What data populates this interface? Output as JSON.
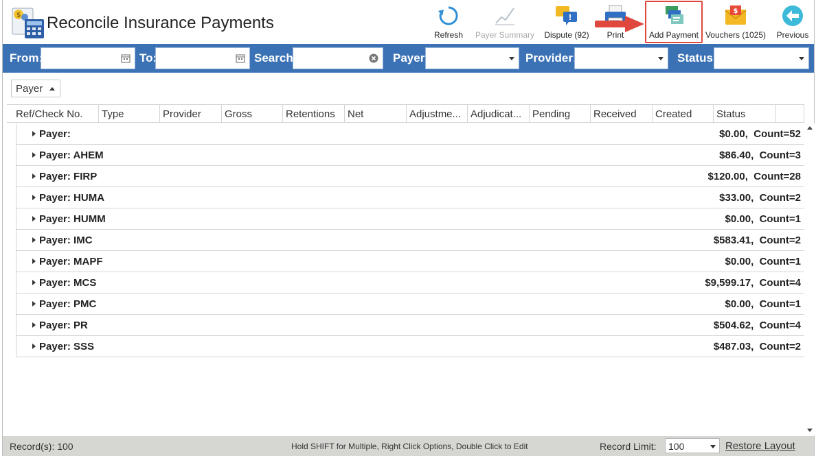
{
  "header": {
    "title": "Reconcile Insurance Payments",
    "app_icon": "calculator-dollar-icon"
  },
  "toolbar": {
    "refresh": {
      "label": "Refresh",
      "icon": "refresh-icon"
    },
    "payer_summary": {
      "label": "Payer Summary",
      "icon": "line-chart-icon",
      "disabled": true
    },
    "dispute": {
      "label": "Dispute (92)",
      "icon": "chat-bubbles-icon"
    },
    "print": {
      "label": "Print",
      "icon": "printer-icon"
    },
    "add_payment": {
      "label": "Add Payment",
      "icon": "add-payment-icon",
      "highlighted": true
    },
    "vouchers": {
      "label": "Vouchers (1025)",
      "icon": "envelope-dollar-icon"
    },
    "previous": {
      "label": "Previous",
      "icon": "back-arrow-icon"
    }
  },
  "filters": {
    "from_label": "From:",
    "from_value": "",
    "to_label": "To:",
    "to_value": "",
    "search_label": "Search:",
    "search_value": "",
    "payer_label": "Payer:",
    "payer_value": "",
    "provider_label": "Provider:",
    "provider_value": "",
    "status_label": "Status:",
    "status_value": ""
  },
  "group_by": {
    "label": "Payer"
  },
  "grid": {
    "columns": [
      "Ref/Check No.",
      "Type",
      "Provider",
      "Gross",
      "Retentions",
      "Net",
      "Adjustme...",
      "Adjudicat...",
      "Pending",
      "Received",
      "Created",
      "Status"
    ],
    "groups": [
      {
        "name": "Payer:",
        "amount": "$0.00",
        "count": "Count=52"
      },
      {
        "name": "Payer: AHEM",
        "amount": "$86.40",
        "count": "Count=3"
      },
      {
        "name": "Payer: FIRP",
        "amount": "$120.00",
        "count": "Count=28"
      },
      {
        "name": "Payer: HUMA",
        "amount": "$33.00",
        "count": "Count=2"
      },
      {
        "name": "Payer: HUMM",
        "amount": "$0.00",
        "count": "Count=1"
      },
      {
        "name": "Payer: IMC",
        "amount": "$583.41",
        "count": "Count=2"
      },
      {
        "name": "Payer: MAPF",
        "amount": "$0.00",
        "count": "Count=1"
      },
      {
        "name": "Payer: MCS",
        "amount": "$9,599.17",
        "count": "Count=4"
      },
      {
        "name": "Payer: PMC",
        "amount": "$0.00",
        "count": "Count=1"
      },
      {
        "name": "Payer: PR",
        "amount": "$504.62",
        "count": "Count=4"
      },
      {
        "name": "Payer: SSS",
        "amount": "$487.03",
        "count": "Count=2"
      }
    ]
  },
  "statusbar": {
    "records": "Record(s): 100",
    "hint": "Hold SHIFT for Multiple, Right Click Options, Double Click to Edit",
    "record_limit_label": "Record Limit:",
    "record_limit_value": "100",
    "restore_layout": "Restore Layout"
  },
  "colors": {
    "filter_bar": "#3b72b5",
    "highlight": "#e0483d",
    "status_bar": "#d6d6d2"
  }
}
